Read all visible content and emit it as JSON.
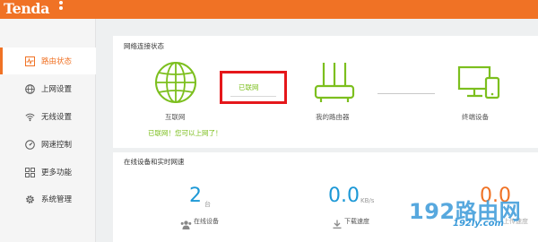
{
  "brand": "Tenda",
  "sidebar": {
    "items": [
      {
        "label": "路由状态",
        "icon": "status-icon"
      },
      {
        "label": "上网设置",
        "icon": "globe-icon"
      },
      {
        "label": "无线设置",
        "icon": "wifi-icon"
      },
      {
        "label": "网速控制",
        "icon": "speedometer-icon"
      },
      {
        "label": "更多功能",
        "icon": "grid-icon"
      },
      {
        "label": "系统管理",
        "icon": "gear-icon"
      }
    ]
  },
  "network": {
    "title": "网络连接状态",
    "internet_label": "互联网",
    "connection_status": "已联网",
    "router_label": "我的路由器",
    "device_label": "终端设备",
    "message": "已联网！您可以上网了！"
  },
  "realtime": {
    "title": "在线设备和实时网速",
    "devices_count": "2",
    "devices_unit": "台",
    "devices_label": "在线设备",
    "download_value": "0.0",
    "download_unit": "KB/s",
    "download_label": "下载速度",
    "upload_value": "0.0",
    "upload_label": "上传速度"
  },
  "watermark": {
    "text": "192路由网",
    "url": "192ly.com"
  },
  "colors": {
    "brand_orange": "#f07225",
    "status_green": "#7cbf1e",
    "value_blue": "#1c98d6",
    "highlight_red": "#e5171b"
  }
}
